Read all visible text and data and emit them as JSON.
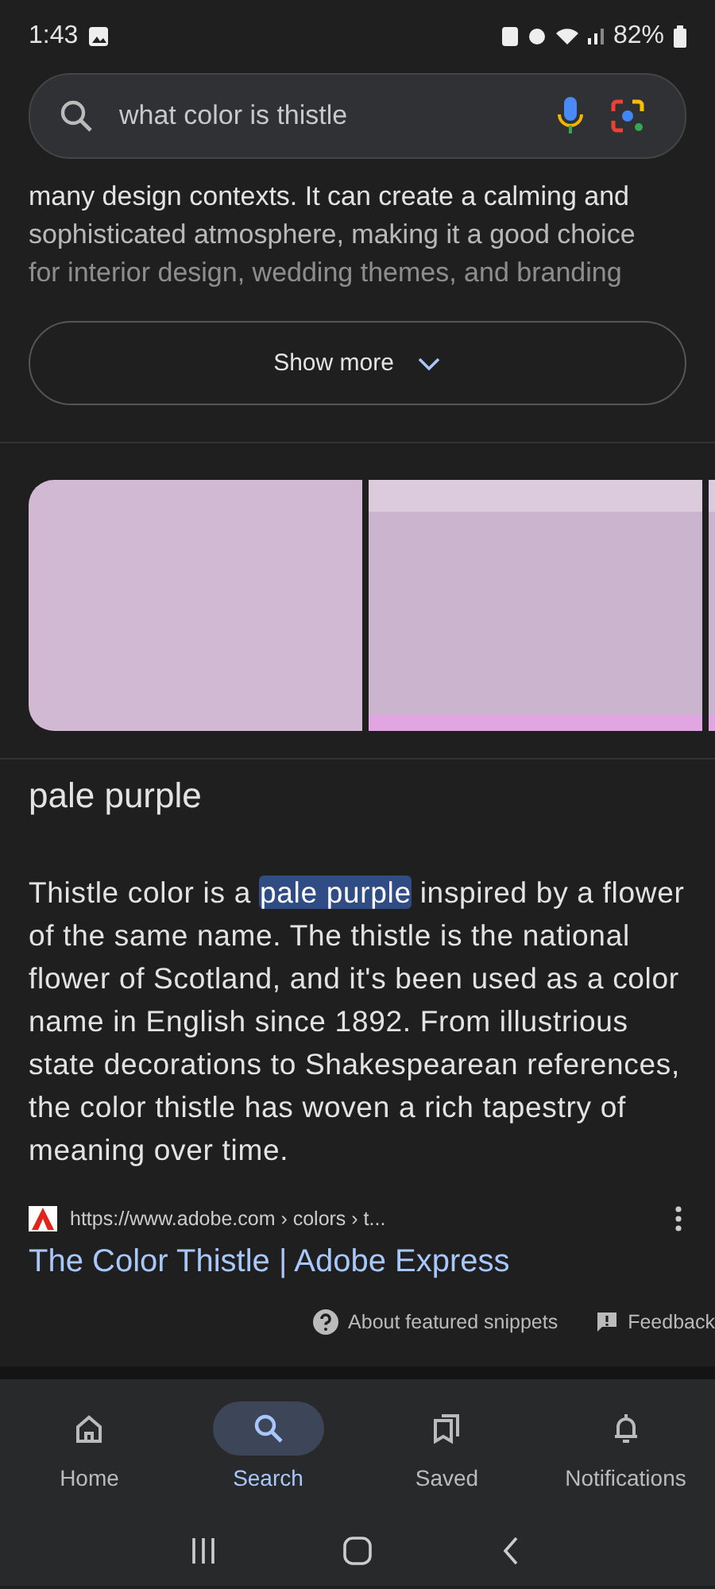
{
  "status_bar": {
    "time": "1:43",
    "battery": "82%"
  },
  "search": {
    "value": "what color is thistle"
  },
  "snippet": {
    "lines": [
      "many design contexts. It can create a calming and",
      "sophisticated atmosphere, making it a good choice",
      "for interior design, wedding themes, and branding"
    ],
    "show_more": "Show more"
  },
  "answer": {
    "title": "pale purple",
    "before": "Thistle color is a ",
    "highlight": "pale purple",
    "after": " inspired by a flower of the same name. The thistle is the national flower of Scotland, and it's been used as a color name in English since 1892. From illustrious state decorations to Shakespearean references, the color thistle has woven a rich tapestry of meaning over time."
  },
  "source": {
    "url": "https://www.adobe.com › colors › t...",
    "title": "The Color Thistle | Adobe Express"
  },
  "footer": {
    "about": "About featured snippets",
    "feedback": "Feedback"
  },
  "nav": [
    {
      "label": "Home",
      "selected": false
    },
    {
      "label": "Search",
      "selected": true
    },
    {
      "label": "Saved",
      "selected": false
    },
    {
      "label": "Notifications",
      "selected": false
    }
  ]
}
